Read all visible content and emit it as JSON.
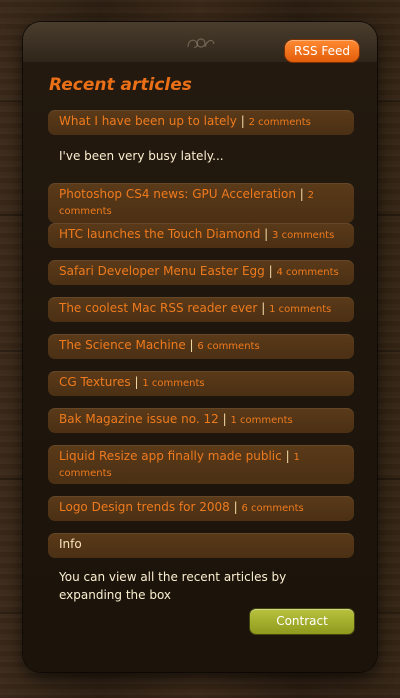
{
  "header": {
    "rss_label": "RSS Feed"
  },
  "section": {
    "title": "Recent articles"
  },
  "articles": [
    {
      "title": "What I have been up to lately",
      "comments": "2 comments",
      "expanded_text": "I've been very busy lately..."
    },
    {
      "title": "Photoshop CS4 news: GPU Acceleration",
      "comments": "2 comments"
    },
    {
      "title": "HTC launches the Touch Diamond",
      "comments": "3 comments"
    },
    {
      "title": "Safari Developer Menu Easter Egg",
      "comments": "4 comments"
    },
    {
      "title": "The coolest Mac RSS reader ever",
      "comments": "1 comments"
    },
    {
      "title": "The Science Machine",
      "comments": "6 comments"
    },
    {
      "title": "CG Textures",
      "comments": "1 comments"
    },
    {
      "title": "Bak Magazine issue no. 12",
      "comments": "1 comments"
    },
    {
      "title": "Liquid Resize app finally made public",
      "comments": "1 comments"
    },
    {
      "title": "Logo Design trends for 2008",
      "comments": "6 comments"
    }
  ],
  "info": {
    "label": "Info",
    "text": "You can view all the recent articles by expanding the box"
  },
  "footer": {
    "contract_label": "Contract"
  },
  "separator": "|",
  "colors": {
    "accent": "#ea6f16",
    "rss_button": "#f27317",
    "contract_button": "#a3ad2b",
    "item_background": "#52351a"
  }
}
